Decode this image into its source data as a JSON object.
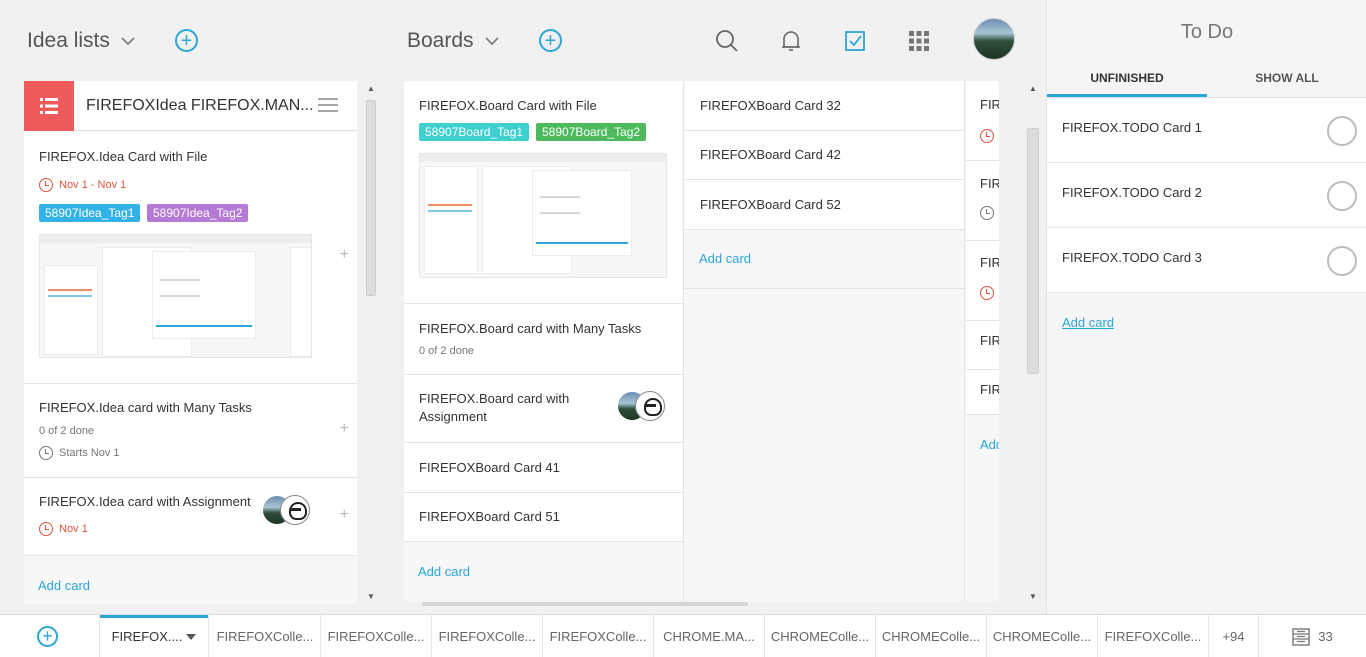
{
  "header": {
    "idea_lists_label": "Idea lists",
    "boards_label": "Boards"
  },
  "idea_list": {
    "title": "FIREFOXIdea FIREFOX.MAN...",
    "cards": [
      {
        "title": "FIREFOX.Idea Card with File",
        "date": "Nov 1 - Nov 1",
        "tags": [
          "58907Idea_Tag1",
          "58907Idea_Tag2"
        ]
      },
      {
        "title": "FIREFOX.Idea card with Many Tasks",
        "tasks": "0 of 2 done",
        "date": "Starts Nov 1"
      },
      {
        "title": "FIREFOX.Idea card with Assignment",
        "date": "Nov 1"
      }
    ],
    "add_card": "Add card"
  },
  "board": {
    "col1": {
      "cards": [
        {
          "title": "FIREFOX.Board Card with File",
          "tags": [
            "58907Board_Tag1",
            "58907Board_Tag2"
          ]
        },
        {
          "title": "FIREFOX.Board card with Many Tasks",
          "tasks": "0 of 2 done"
        },
        {
          "title": "FIREFOX.Board card with Assignment"
        },
        {
          "title": "FIREFOXBoard Card 41"
        },
        {
          "title": "FIREFOXBoard Card 51"
        }
      ],
      "add_card": "Add card"
    },
    "col2": {
      "cards": [
        {
          "title": "FIREFOXBoard Card 32"
        },
        {
          "title": "FIREFOXBoard Card 42"
        },
        {
          "title": "FIREFOXBoard Card 52"
        }
      ],
      "add_card": "Add card"
    },
    "col3": {
      "cards": [
        "FIR",
        "FIR",
        "FIR",
        "FIR",
        "FIR"
      ],
      "add_card": "Add"
    }
  },
  "todo": {
    "title": "To Do",
    "tab_unfinished": "UNFINISHED",
    "tab_show_all": "SHOW ALL",
    "items": [
      "FIREFOX.TODO Card 1",
      "FIREFOX.TODO Card 2",
      "FIREFOX.TODO Card 3"
    ],
    "add_card": "Add card"
  },
  "bottom_tabs": [
    "FIREFOX....",
    "FIREFOXColle...",
    "FIREFOXColle...",
    "FIREFOXColle...",
    "FIREFOXColle...",
    "CHROME.MA...",
    "CHROMEColle...",
    "CHROMEColle...",
    "CHROMEColle...",
    "FIREFOXColle..."
  ],
  "bottom_more": "+94",
  "bottom_count": "33",
  "colors": {
    "accent": "#2ba6d8",
    "tag_teal": "#3ecfcf",
    "tag_green": "#4cbb5d",
    "tag_blue": "#33b2e8",
    "tag_purple": "#b57ad6",
    "idea_header_red": "#ef5b5b",
    "date_red": "#e5533c"
  }
}
